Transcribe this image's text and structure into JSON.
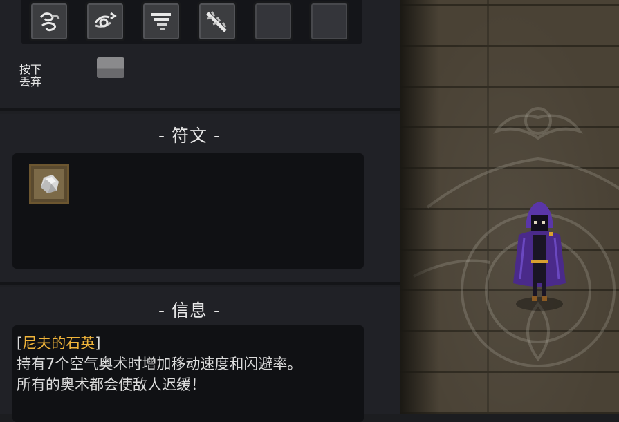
{
  "drop": {
    "label_line1": "按下",
    "label_line2": "丢弃"
  },
  "arcana_slots": [
    {
      "icon": "wind-swirl-icon",
      "filled": true
    },
    {
      "icon": "air-dash-icon",
      "filled": true
    },
    {
      "icon": "tornado-icon",
      "filled": true
    },
    {
      "icon": "wind-blade-icon",
      "filled": true
    },
    {
      "icon": "empty-slot",
      "filled": false
    },
    {
      "icon": "empty-slot",
      "filled": false
    }
  ],
  "runes": {
    "title": "- 符文 -",
    "items": [
      {
        "icon": "quartz-icon"
      }
    ]
  },
  "info": {
    "title": "- 信息 -",
    "bracket_open": "[",
    "item_name": "尼夫的石英",
    "bracket_close": "]",
    "line1": "持有7个空气奥术时增加移动速度和闪避率。",
    "line2": "所有的奥术都会使敌人迟缓！"
  },
  "colors": {
    "item_name": "#f0b43a",
    "cloak": "#4a2a8a",
    "floor": "#4a4235"
  }
}
